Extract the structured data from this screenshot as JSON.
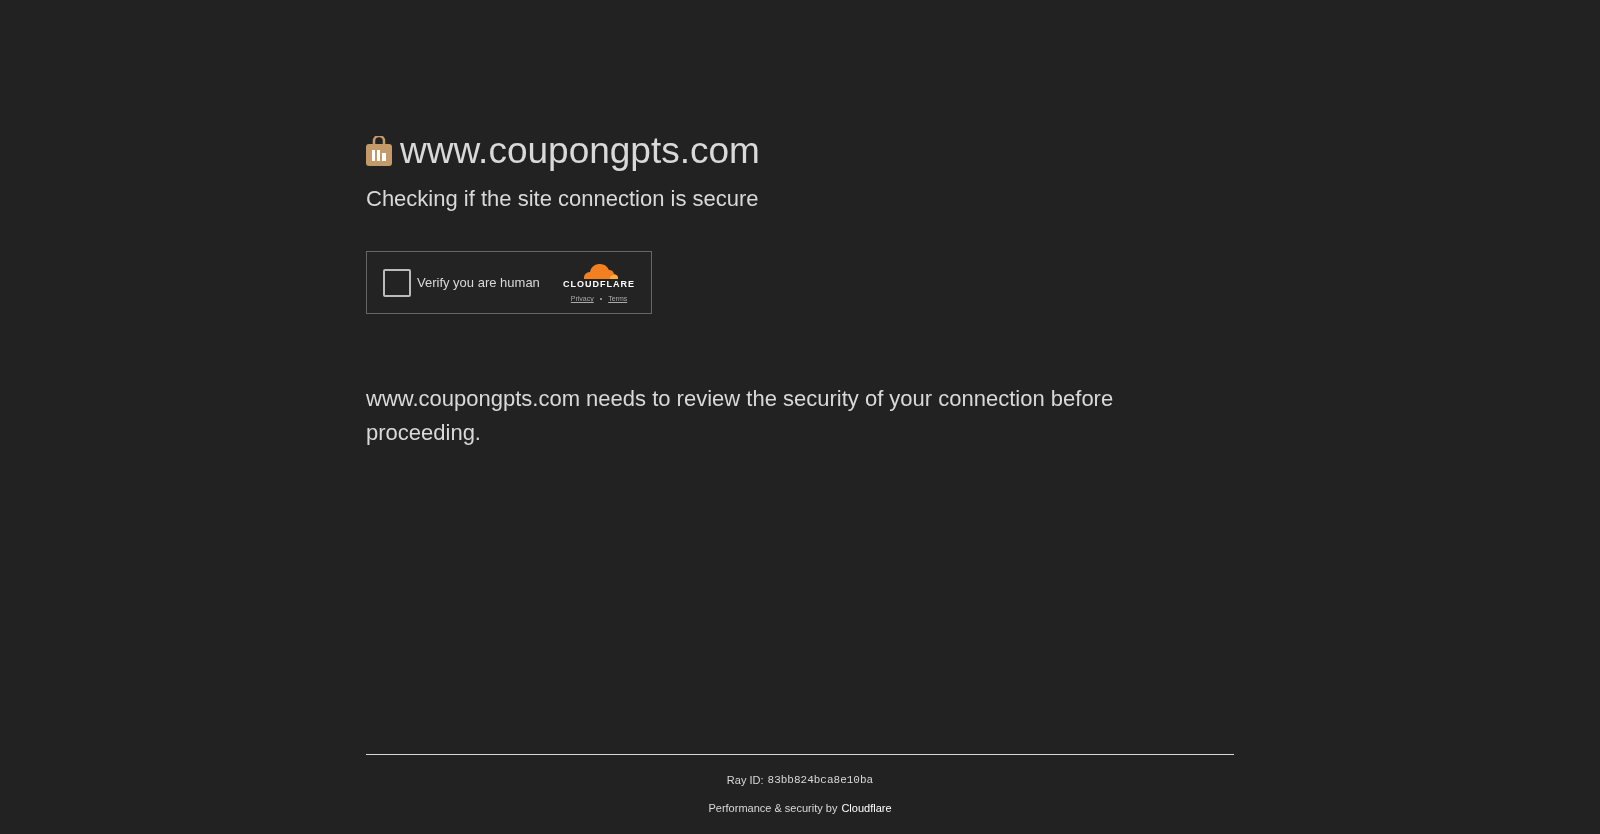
{
  "site": {
    "domain": "www.coupongpts.com",
    "subtitle": "Checking if the site connection is secure"
  },
  "challenge": {
    "label": "Verify you are human",
    "checked": false,
    "brand": "CLOUDFLARE",
    "links": [
      "Privacy",
      "Terms"
    ],
    "separator": "•"
  },
  "message": "www.coupongpts.com needs to review the security of your connection before proceeding.",
  "footer": {
    "ray_label": "Ray ID:",
    "ray_id": "83bb824bca8e10ba",
    "credit": "Performance & security by",
    "credit_link": "Cloudflare"
  }
}
